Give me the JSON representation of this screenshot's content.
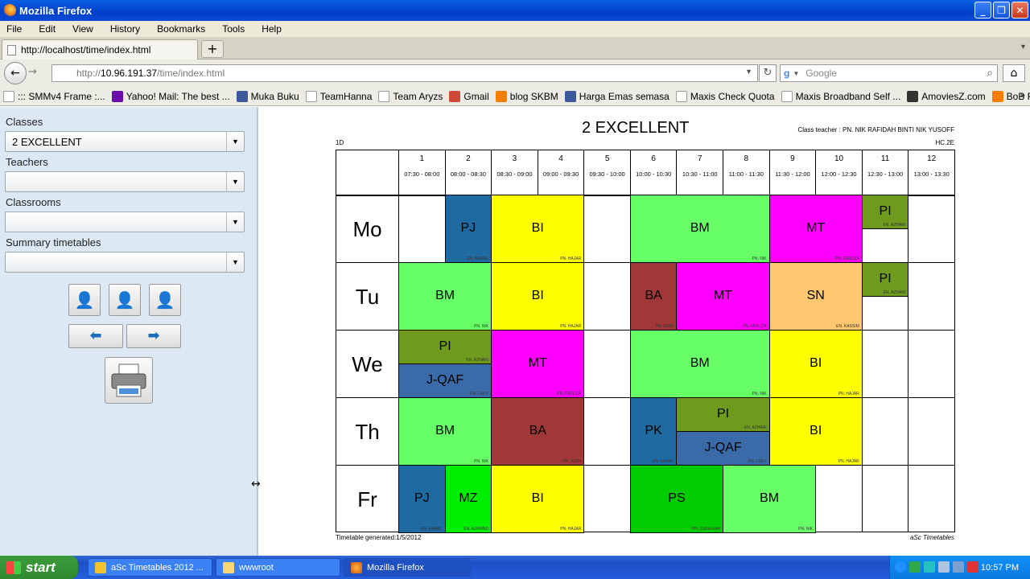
{
  "window": {
    "title": "Mozilla Firefox"
  },
  "menu": [
    "File",
    "Edit",
    "View",
    "History",
    "Bookmarks",
    "Tools",
    "Help"
  ],
  "tab": {
    "title": "http://localhost/time/index.html"
  },
  "url": {
    "prefix": "http://",
    "domain": "10.96.191.37",
    "path": "/time/index.html"
  },
  "search": {
    "placeholder": "Google"
  },
  "bookmarks": [
    {
      "label": "::: SMMv4 Frame :...",
      "icon": "page-icon"
    },
    {
      "label": "Yahoo! Mail: The best ...",
      "icon": "yahoo-icon"
    },
    {
      "label": "Muka Buku",
      "icon": "facebook-icon"
    },
    {
      "label": "TeamHanna",
      "icon": "page-icon"
    },
    {
      "label": "Team Aryzs",
      "icon": "page-icon"
    },
    {
      "label": "Gmail",
      "icon": "gmail-icon"
    },
    {
      "label": "blog SKBM",
      "icon": "blogger-icon"
    },
    {
      "label": "Harga Emas semasa",
      "icon": "facebook-icon"
    },
    {
      "label": "Maxis Check Quota",
      "icon": "page-icon"
    },
    {
      "label": "Maxis Broadband Self ...",
      "icon": "page-icon"
    },
    {
      "label": "AmoviesZ.com",
      "icon": "joomla-icon"
    },
    {
      "label": "BoB Releases",
      "icon": "blogger-icon"
    }
  ],
  "sidebar": {
    "classes_label": "Classes",
    "classes_value": "2 EXCELLENT",
    "teachers_label": "Teachers",
    "teachers_value": "",
    "classrooms_label": "Classrooms",
    "classrooms_value": "",
    "summary_label": "Summary timetables",
    "summary_value": ""
  },
  "timetable": {
    "title": "2 EXCELLENT",
    "teacher": "Class teacher : PN. NIK RAFIDAH BINTI NIK YUSOFF",
    "code": "HC.2E",
    "left": "1D",
    "generated": "Timetable generated:1/5/2012",
    "brand": "aSc Timetables",
    "periods": [
      {
        "n": "1",
        "t": "07:30 - 08:00"
      },
      {
        "n": "2",
        "t": "08:00 - 08:30"
      },
      {
        "n": "3",
        "t": "08:30 - 09:00"
      },
      {
        "n": "4",
        "t": "09:00 - 09:30"
      },
      {
        "n": "5",
        "t": "09:30 - 10:00"
      },
      {
        "n": "6",
        "t": "10:00 - 10:30"
      },
      {
        "n": "7",
        "t": "10:30 - 11:00"
      },
      {
        "n": "8",
        "t": "11:00 - 11:30"
      },
      {
        "n": "9",
        "t": "11:30 - 12:00"
      },
      {
        "n": "10",
        "t": "12:00 - 12:30"
      },
      {
        "n": "11",
        "t": "12:30 - 13:00"
      },
      {
        "n": "12",
        "t": "13:00 - 13:30"
      }
    ],
    "days": [
      "Mo",
      "Tu",
      "We",
      "Th",
      "Fr"
    ],
    "lessons": [
      {
        "day": 0,
        "start": 1,
        "span": 1,
        "subj": "PJ",
        "teacher": "EN. KAMAL",
        "color": "#1f6aa0"
      },
      {
        "day": 0,
        "start": 2,
        "span": 2,
        "subj": "BI",
        "teacher": "PN. HAJAR",
        "color": "#ffff00"
      },
      {
        "day": 0,
        "start": 5,
        "span": 3,
        "subj": "BM",
        "teacher": "PN. NIK",
        "color": "#66ff66"
      },
      {
        "day": 0,
        "start": 8,
        "span": 2,
        "subj": "MT",
        "teacher": "PN. FADLIZA",
        "color": "#ff00ff"
      },
      {
        "day": 0,
        "start": 10,
        "span": 1,
        "subj": "PI",
        "teacher": "EN. AZHARI",
        "color": "#6e9a1e",
        "half": "top"
      },
      {
        "day": 1,
        "start": 0,
        "span": 2,
        "subj": "BM",
        "teacher": "PN. NIK",
        "color": "#66ff66"
      },
      {
        "day": 1,
        "start": 2,
        "span": 2,
        "subj": "BI",
        "teacher": "PN. HAJAR",
        "color": "#ffff00"
      },
      {
        "day": 1,
        "start": 5,
        "span": 1,
        "subj": "BA",
        "teacher": "PN. AZAN",
        "color": "#a03838"
      },
      {
        "day": 1,
        "start": 6,
        "span": 2,
        "subj": "MT",
        "teacher": "PN. FADLIZA",
        "color": "#ff00ff"
      },
      {
        "day": 1,
        "start": 8,
        "span": 2,
        "subj": "SN",
        "teacher": "EN. KASSIM",
        "color": "#ffc870"
      },
      {
        "day": 1,
        "start": 10,
        "span": 1,
        "subj": "PI",
        "teacher": "EN. AZHARI",
        "color": "#6e9a1e",
        "half": "top"
      },
      {
        "day": 2,
        "start": 0,
        "span": 2,
        "subj": "PI",
        "teacher": "EN. AZHARI",
        "color": "#6e9a1e",
        "half": "top"
      },
      {
        "day": 2,
        "start": 0,
        "span": 2,
        "subj": "J-QAF",
        "teacher": "PN. LAILY",
        "color": "#3a6aa8",
        "half": "bottom"
      },
      {
        "day": 2,
        "start": 2,
        "span": 2,
        "subj": "MT",
        "teacher": "PN. FADLIZA",
        "color": "#ff00ff"
      },
      {
        "day": 2,
        "start": 5,
        "span": 3,
        "subj": "BM",
        "teacher": "PN. NIK",
        "color": "#66ff66"
      },
      {
        "day": 2,
        "start": 8,
        "span": 2,
        "subj": "BI",
        "teacher": "PN. HAJAR",
        "color": "#ffff00"
      },
      {
        "day": 3,
        "start": 0,
        "span": 2,
        "subj": "BM",
        "teacher": "PN. NIK",
        "color": "#66ff66"
      },
      {
        "day": 3,
        "start": 2,
        "span": 2,
        "subj": "BA",
        "teacher": "PN. AZAN",
        "color": "#a03838"
      },
      {
        "day": 3,
        "start": 5,
        "span": 1,
        "subj": "PK",
        "teacher": "EN. KAMAL",
        "color": "#1f6aa0"
      },
      {
        "day": 3,
        "start": 6,
        "span": 2,
        "subj": "PI",
        "teacher": "EN. AZHARI",
        "color": "#6e9a1e",
        "half": "top"
      },
      {
        "day": 3,
        "start": 6,
        "span": 2,
        "subj": "J-QAF",
        "teacher": "PN. LAILY",
        "color": "#3a6aa8",
        "half": "bottom"
      },
      {
        "day": 3,
        "start": 8,
        "span": 2,
        "subj": "BI",
        "teacher": "PN. HAJAR",
        "color": "#ffff00"
      },
      {
        "day": 4,
        "start": 0,
        "span": 1,
        "subj": "PJ",
        "teacher": "EN. KAMAL",
        "color": "#1f6aa0"
      },
      {
        "day": 4,
        "start": 1,
        "span": 1,
        "subj": "MZ",
        "teacher": "EN. AZWAND",
        "color": "#00ee00"
      },
      {
        "day": 4,
        "start": 2,
        "span": 2,
        "subj": "BI",
        "teacher": "PN. HAJAR",
        "color": "#ffff00"
      },
      {
        "day": 4,
        "start": 5,
        "span": 2,
        "subj": "PS",
        "teacher": "PN. ZURAINAH",
        "color": "#00cc00"
      },
      {
        "day": 4,
        "start": 7,
        "span": 2,
        "subj": "BM",
        "teacher": "PN. NIK",
        "color": "#66ff66"
      }
    ]
  },
  "taskbar": {
    "start": "start",
    "tasks": [
      "aSc Timetables 2012 ...",
      "wwwroot",
      "Mozilla Firefox"
    ],
    "clock": "10:57 PM"
  }
}
